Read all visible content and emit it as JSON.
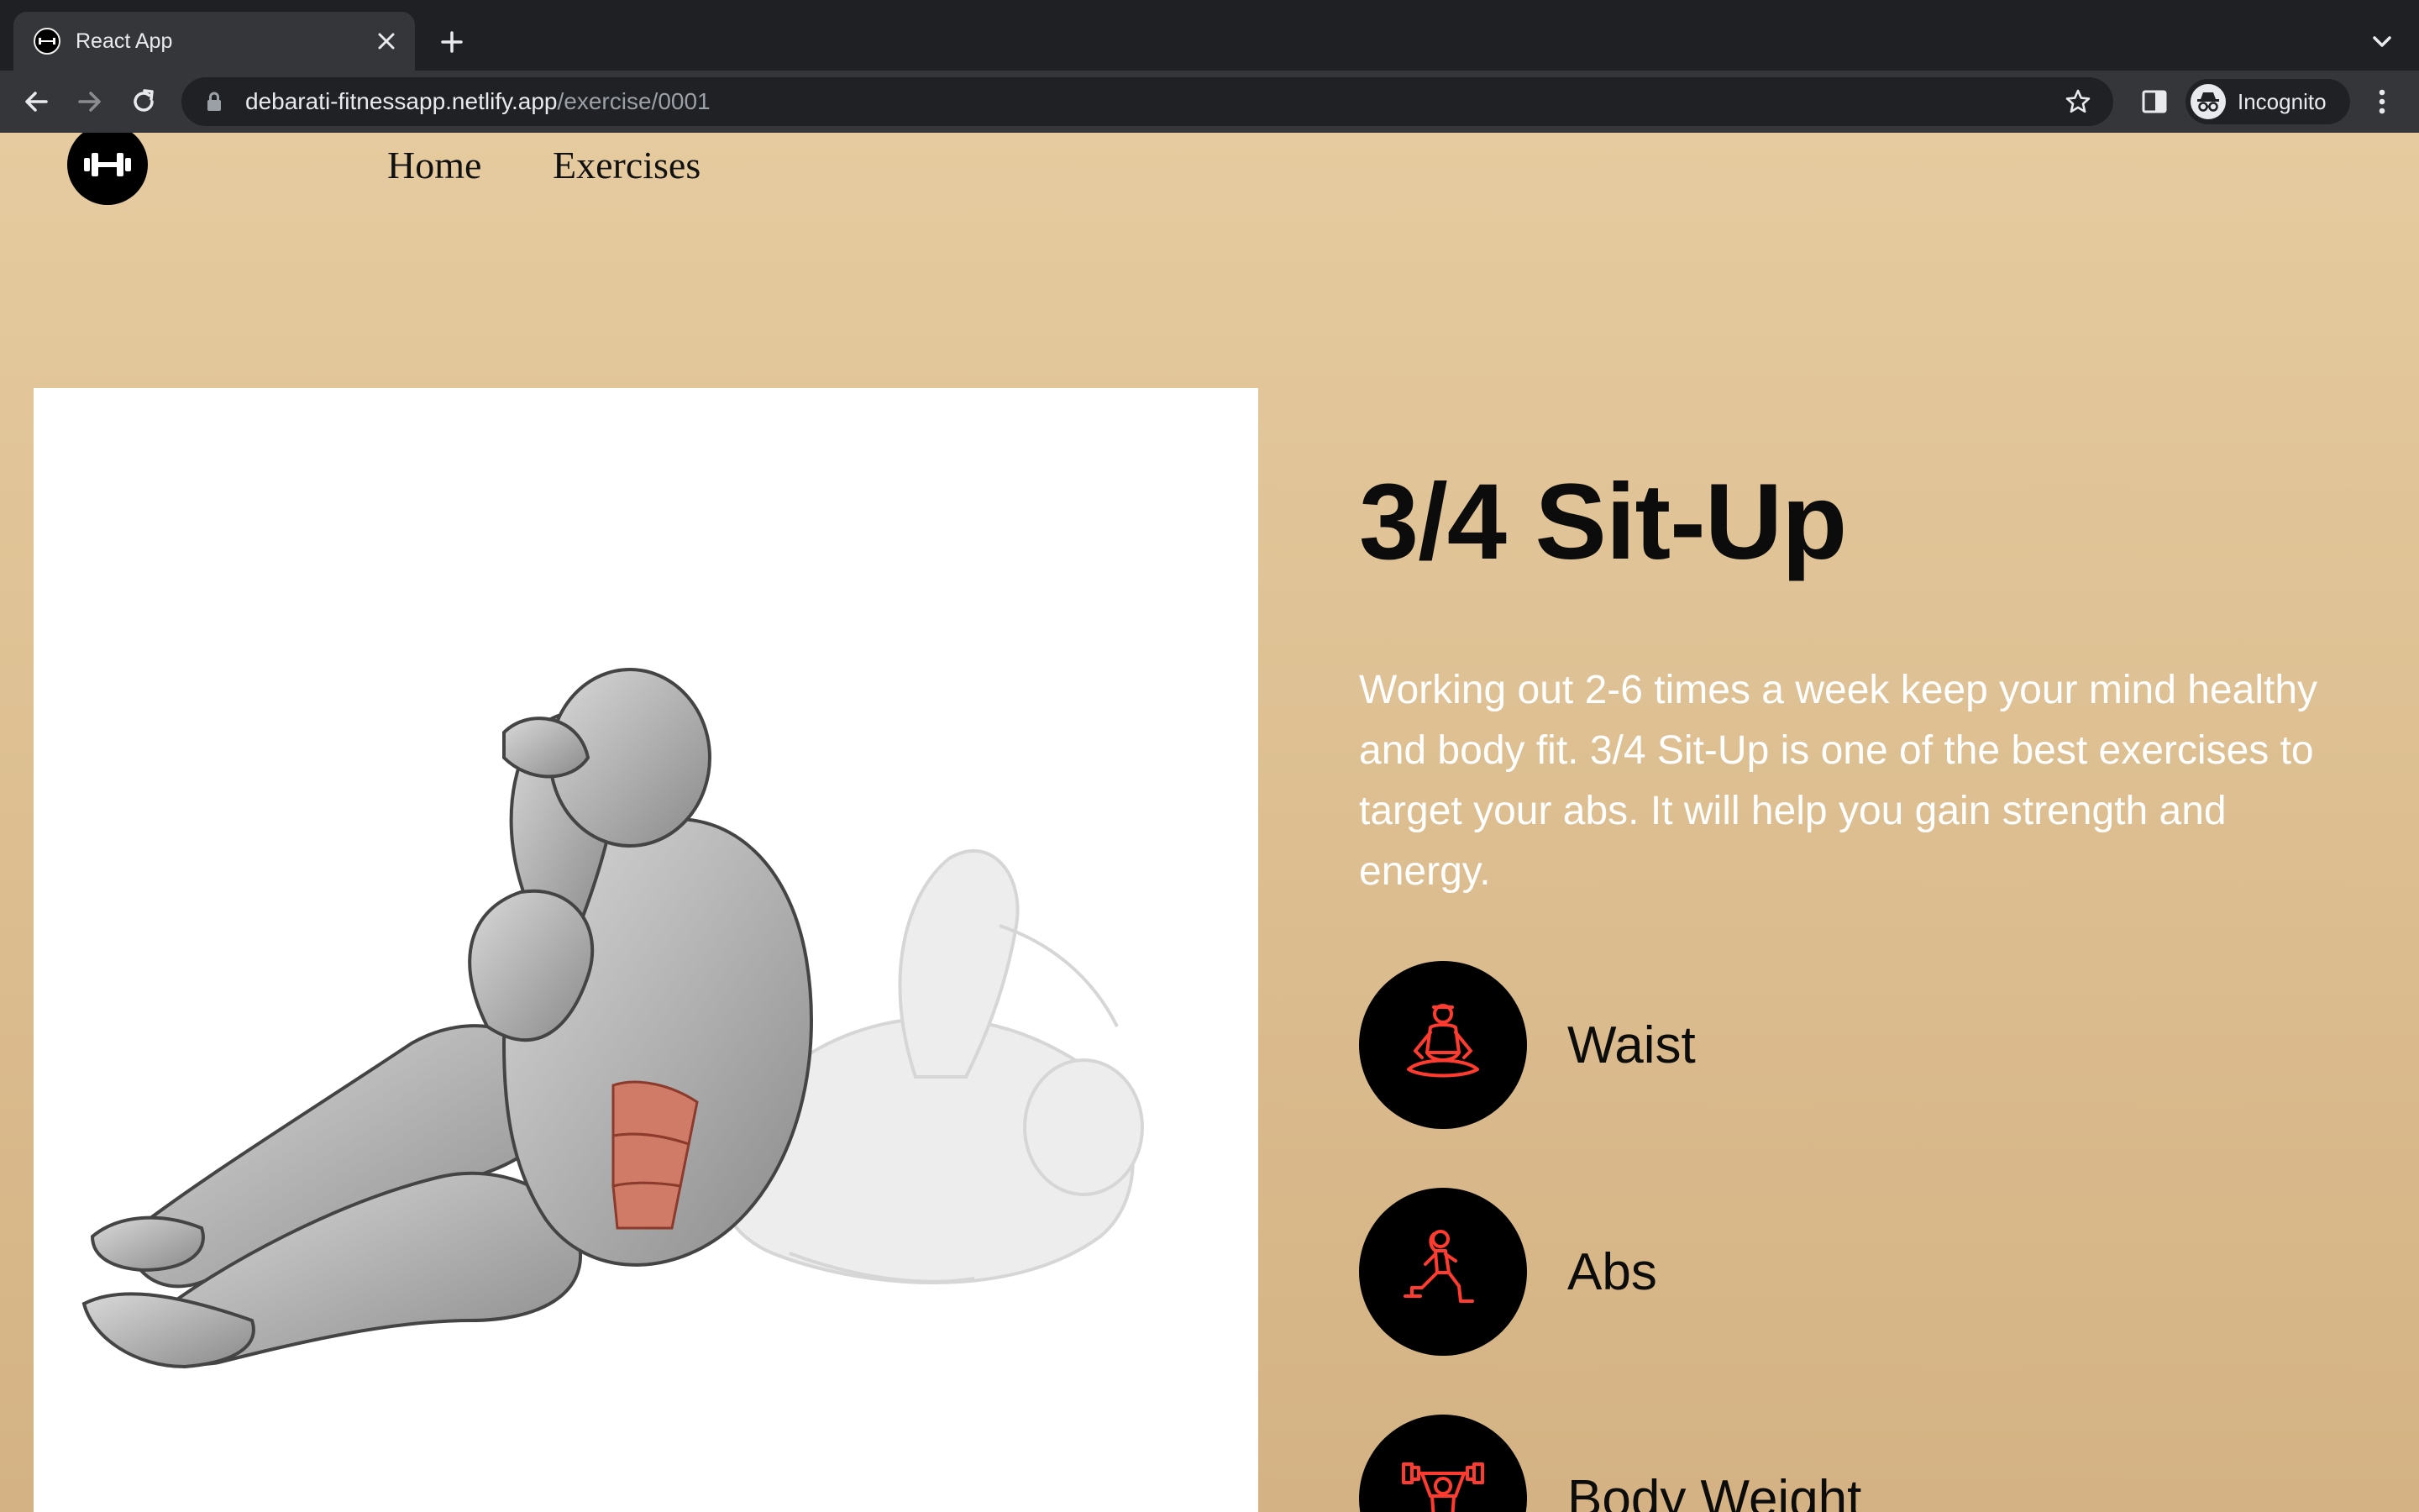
{
  "browser": {
    "tab_title": "React App",
    "url_host": "debarati-fitnessapp.netlify.app",
    "url_path": "/exercise/0001",
    "profile_label": "Incognito"
  },
  "nav": {
    "home_label": "Home",
    "exercises_label": "Exercises"
  },
  "exercise": {
    "name": "3/4 Sit-Up",
    "description": "Working out 2-6 times a week keep your mind healthy and body fit. 3/4 Sit-Up is one of the best exercises to target your abs. It will help you gain strength and energy.",
    "details": [
      {
        "label": "Waist",
        "icon": "meditation-icon"
      },
      {
        "label": "Abs",
        "icon": "lunge-icon"
      },
      {
        "label": "Body Weight",
        "icon": "weightlifting-icon"
      }
    ]
  },
  "colors": {
    "page_top": "#e5cb9f",
    "page_bottom": "#d4b283",
    "icon_accent": "#ff3b30",
    "chrome_dark": "#1f2024",
    "chrome_toolbar": "#35363a"
  }
}
